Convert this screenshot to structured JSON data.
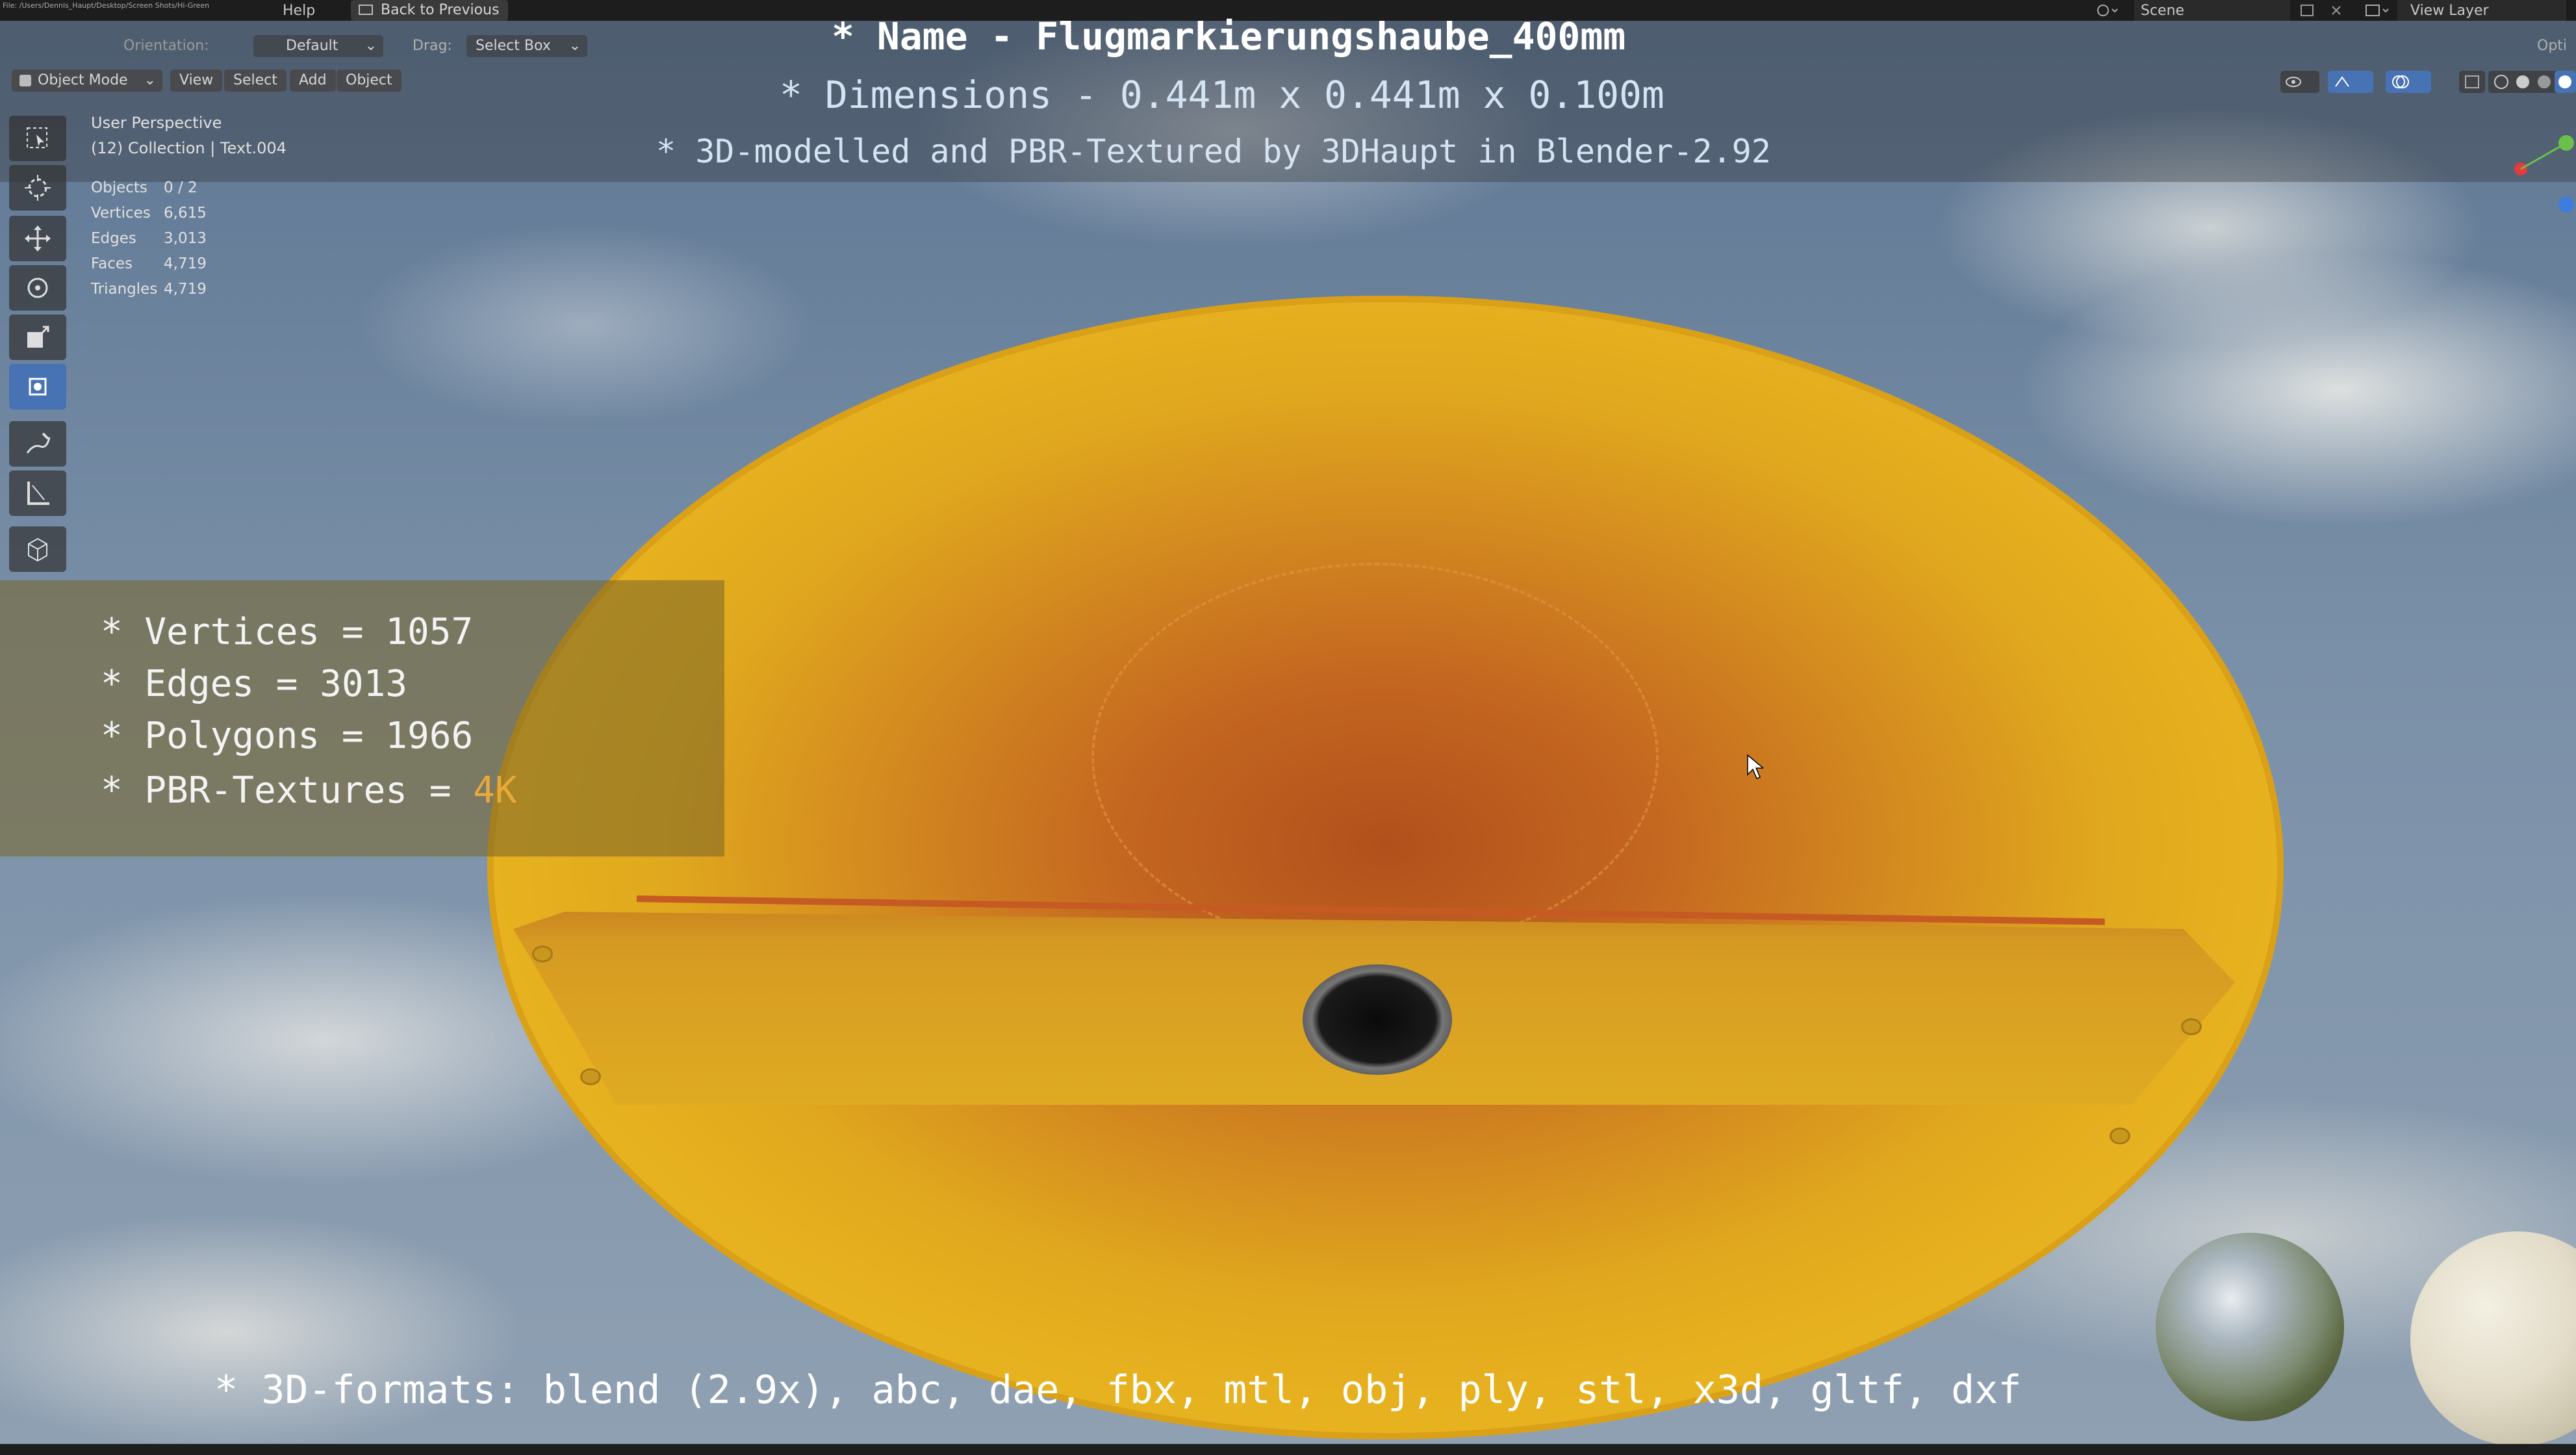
{
  "topbar": {
    "file_path_line": "File: /Users/Dennis_Haupt/Desktop/Screen Shots/Hi-Green",
    "help": "Help",
    "back": "Back to Previous",
    "scene": "Scene",
    "view_layer": "View Layer"
  },
  "header": {
    "orientation": "Orientation:",
    "orientation_value": "Default",
    "drag_label": "Drag:",
    "drag_value": "Select Box",
    "mode": "Object Mode",
    "menu": [
      "View",
      "Select",
      "Add",
      "Object"
    ],
    "options": "Opti"
  },
  "viewport": {
    "perspective": "User Perspective",
    "collection": "(12) Collection | Text.004",
    "stats": [
      {
        "label": "Objects",
        "value": "0 / 2"
      },
      {
        "label": "Vertices",
        "value": "6,615"
      },
      {
        "label": "Edges",
        "value": "3,013"
      },
      {
        "label": "Faces",
        "value": "4,719"
      },
      {
        "label": "Triangles",
        "value": "4,719"
      }
    ]
  },
  "overlay": {
    "name_line": "* Name - Flugmarkierungshaube_400mm",
    "dimensions_line": "* Dimensions -  0.441m x 0.441m x 0.100m",
    "credit_line": "* 3D-modelled and PBR-Textured by 3DHaupt in Blender-2.92",
    "info": {
      "vertices": "* Vertices = 1057",
      "edges": "* Edges = 3013",
      "polygons": "* Polygons = 1966",
      "textures_prefix": "* PBR-Textures = ",
      "textures_value": "4K"
    },
    "formats_line": "* 3D-formats: blend (2.9x), abc, dae, fbx, mtl, obj, ply, stl, x3d, gltf, dxf"
  },
  "colors": {
    "accent_orange": "#e8a93a",
    "tool_active": "#4772b3",
    "disk_yellow": "#e2aa1f"
  },
  "icons": [
    "select-box-icon",
    "cursor-icon",
    "move-icon",
    "rotate-icon",
    "scale-icon",
    "transform-icon",
    "annotate-icon",
    "measure-icon",
    "add-cube-icon"
  ]
}
